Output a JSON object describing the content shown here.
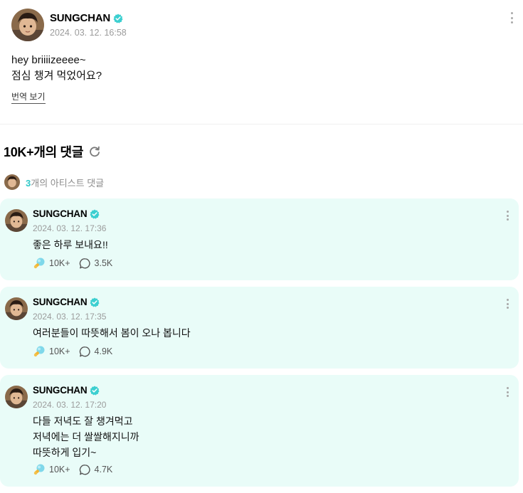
{
  "post": {
    "author": "SUNGCHAN",
    "timestamp": "2024. 03. 12. 16:58",
    "lines": [
      "hey briiiizeeee~",
      "점심 챙겨 먹었어요?"
    ],
    "translate_label": "번역 보기"
  },
  "comments_section": {
    "title": "10K+개의 댓글",
    "artist_count": "3",
    "artist_label": "개의 아티스트 댓글"
  },
  "comments": [
    {
      "author": "SUNGCHAN",
      "timestamp": "2024. 03. 12. 17:36",
      "lines": [
        "좋은 하루 보내요!!"
      ],
      "likes": "10K+",
      "replies": "3.5K"
    },
    {
      "author": "SUNGCHAN",
      "timestamp": "2024. 03. 12. 17:35",
      "lines": [
        "여러분들이 따뜻해서 봄이 오나 봅니다"
      ],
      "likes": "10K+",
      "replies": "4.9K"
    },
    {
      "author": "SUNGCHAN",
      "timestamp": "2024. 03. 12. 17:20",
      "lines": [
        "다들 저녁도 잘 챙겨먹고",
        "저녁에는 더 쌀쌀해지니까",
        "따뜻하게 입기~"
      ],
      "likes": "10K+",
      "replies": "4.7K"
    }
  ],
  "icons": {
    "verified": "verified-badge-icon",
    "more": "more-vertical-icon",
    "refresh": "refresh-icon",
    "like": "lightstick-cheer-icon",
    "reply": "speech-bubble-icon"
  },
  "colors": {
    "verified": "#3ccfd0",
    "artist_count": "#2fc8c8",
    "card_bg": "#e9fcf8"
  }
}
